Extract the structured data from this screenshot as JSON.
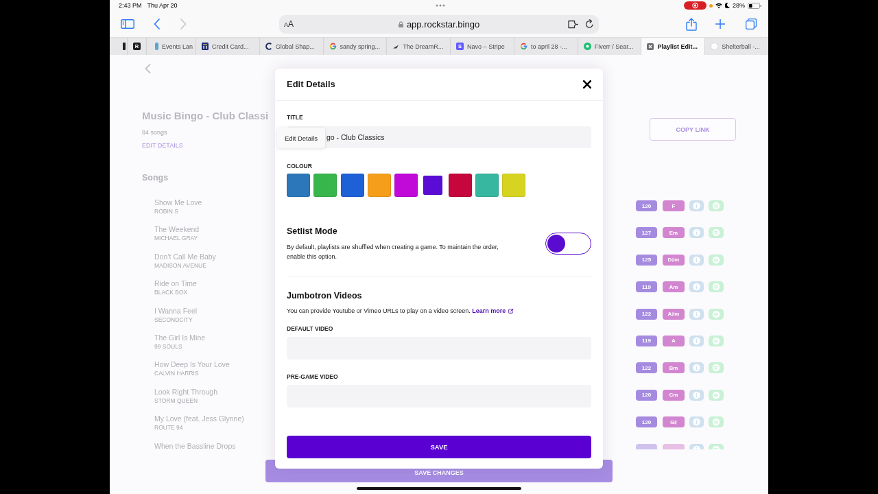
{
  "status_bar": {
    "time": "2:43 PM",
    "date": "Thu Apr 20",
    "battery": "28%"
  },
  "browser": {
    "nav": [
      {
        "kind": "back",
        "disabled": false
      },
      {
        "kind": "forward",
        "disabled": true
      }
    ],
    "text_size": "AA",
    "address": "app.rockstar.bingo",
    "tabs": [
      {
        "kind": "sliver",
        "selected": false
      },
      {
        "kind": "letter",
        "letter": "R",
        "color": "#1c1c1e",
        "selected": false
      },
      {
        "kind": "pill",
        "label": "Events Lan",
        "selected": false
      },
      {
        "kind": "bank",
        "label": "Credit Card...",
        "selected": false
      },
      {
        "kind": "ring",
        "label": "Global Shap...",
        "selected": false
      },
      {
        "kind": "g",
        "label": "sandy spring...",
        "selected": false
      },
      {
        "kind": "wing",
        "label": "The DreamR...",
        "selected": false
      },
      {
        "kind": "letter",
        "letter": "S",
        "color": "#635bff",
        "label": "Navo – Stripe",
        "selected": false
      },
      {
        "kind": "g",
        "label": "to april 28 -...",
        "selected": false
      },
      {
        "kind": "disc",
        "label": "Fiverr / Sear...",
        "selected": false
      },
      {
        "kind": "x-square",
        "label": "Playlist Edit...",
        "selected": true
      },
      {
        "kind": "circle",
        "label": "Shelterball -...",
        "selected": false
      }
    ]
  },
  "page": {
    "title": "Music Bingo - Club Classi",
    "song_count": "84 songs",
    "edit_link": "EDIT DETAILS",
    "songs_heading": "Songs",
    "copy_link": "COPY LINK",
    "songs": [
      {
        "title": "Show Me Love",
        "artist": "ROBIN S",
        "bpm": "120",
        "key": "F"
      },
      {
        "title": "The Weekend",
        "artist": "MICHAEL GRAY",
        "bpm": "127",
        "key": "Em"
      },
      {
        "title": "Don’t Call Me Baby",
        "artist": "MADISON AVENUE",
        "bpm": "125",
        "key": "D♯m"
      },
      {
        "title": "Ride on Time",
        "artist": "BLACK BOX",
        "bpm": "119",
        "key": "Am"
      },
      {
        "title": "I Wanna Feel",
        "artist": "SECONDCITY",
        "bpm": "122",
        "key": "A♯m"
      },
      {
        "title": "The Girl Is Mine",
        "artist": "99 SOULS",
        "bpm": "119",
        "key": "A"
      },
      {
        "title": "How Deep Is Your Love",
        "artist": "CALVIN HARRIS",
        "bpm": "122",
        "key": "Bm"
      },
      {
        "title": "Look Right Through",
        "artist": "STORM QUEEN",
        "bpm": "120",
        "key": "Cm"
      },
      {
        "title": "My Love (feat. Jess Glynne)",
        "artist": "ROUTE 94",
        "bpm": "120",
        "key": "G♯"
      },
      {
        "title": "When the Bassline Drops"
      }
    ],
    "save_changes": "SAVE CHANGES"
  },
  "modal": {
    "title": "Edit Details",
    "title_label": "TITLE",
    "title_value": "go - Club Classics",
    "tooltip": "Edit Details",
    "colour_label": "COLOUR",
    "colours": [
      {
        "color": "#2b77b9",
        "selected": false
      },
      {
        "color": "#37b64c",
        "selected": false
      },
      {
        "color": "#1e60d6",
        "selected": false
      },
      {
        "color": "#f59e1b",
        "selected": false
      },
      {
        "color": "#c10ad8",
        "selected": false
      },
      {
        "color": "#5b0bd6",
        "selected": true
      },
      {
        "color": "#c5073d",
        "selected": false
      },
      {
        "color": "#37b6a0",
        "selected": false
      },
      {
        "color": "#d6d420",
        "selected": false
      }
    ],
    "setlist": {
      "heading": "Setlist Mode",
      "description": "By default, playlists are shuffled when creating a game. To maintain the order, enable this option.",
      "on": false
    },
    "jumbotron": {
      "heading": "Jumbotron Videos",
      "description": "You can provide Youtube or Vimeo URLs to play on a video screen.",
      "link": "Learn more",
      "fields": [
        {
          "label": "DEFAULT VIDEO"
        },
        {
          "label": "PRE-GAME VIDEO"
        }
      ]
    },
    "save": "SAVE"
  }
}
